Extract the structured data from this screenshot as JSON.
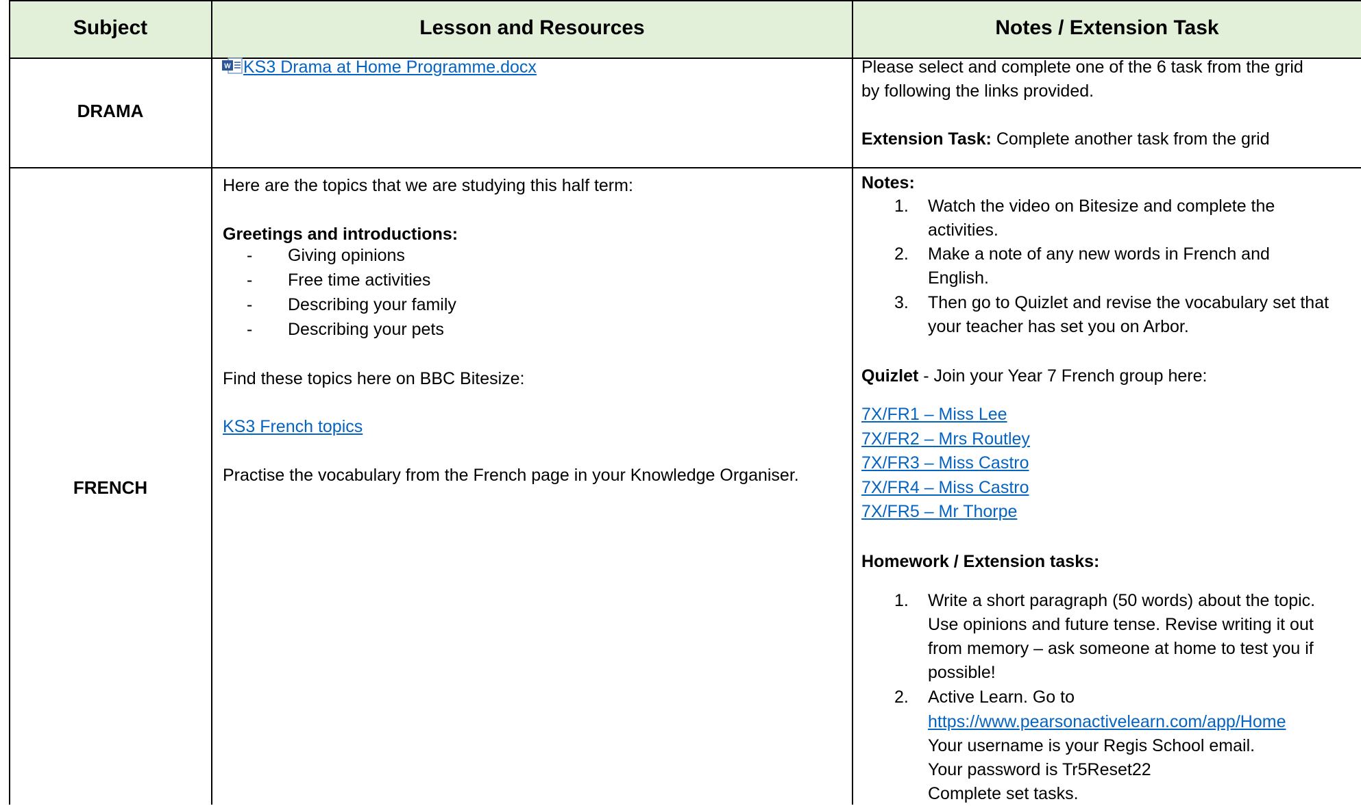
{
  "table": {
    "headers": {
      "subject": "Subject",
      "lesson": "Lesson and Resources",
      "notes": "Notes / Extension Task"
    }
  },
  "drama": {
    "subject": "DRAMA",
    "file_icon": "word-document-icon",
    "resource_link": "KS3 Drama at Home Programme.docx",
    "notes_line1": "Please select and complete one of the 6 task from the grid",
    "notes_line2": "by following the links provided.",
    "extension_label": "Extension Task:",
    "extension_text": " Complete another task from the grid"
  },
  "french": {
    "subject": "FRENCH",
    "intro": "Here are the topics that we are studying this half term:",
    "topic_heading": "Greetings and introductions:",
    "topics": [
      "Giving opinions",
      "Free time activities",
      "Describing your family",
      "Describing your pets"
    ],
    "bitesize_intro": "Find these topics here on BBC Bitesize:",
    "bitesize_link": "KS3 French topics",
    "practise": "Practise the vocabulary from the French page in your Knowledge Organiser.",
    "notes_label": "Notes:",
    "notes": [
      {
        "num": "1.",
        "lines": [
          "Watch the video on Bitesize and complete the",
          "activities."
        ]
      },
      {
        "num": "2.",
        "lines": [
          "Make a note of any new words in French and",
          "English."
        ]
      },
      {
        "num": "3.",
        "lines": [
          "Then go to Quizlet and revise the vocabulary set that",
          "your teacher has set you on Arbor."
        ]
      }
    ],
    "quizlet_label": "Quizlet",
    "quizlet_text": " - Join your Year 7 French group here:",
    "quizlet_links": [
      "7X/FR1 – Miss Lee",
      "7X/FR2 – Mrs Routley",
      "7X/FR3 – Miss Castro",
      "7X/FR4 – Miss Castro",
      "7X/FR5 – Mr Thorpe"
    ],
    "homework_label": "Homework / Extension tasks:",
    "task1": {
      "num": "1.",
      "lines": [
        "Write a short paragraph (50 words) about the topic.",
        "Use opinions and future tense. Revise writing it out",
        "from memory – ask someone at home to test you if",
        "possible!"
      ]
    },
    "task2": {
      "num": "2.",
      "line1": "Active Learn. Go to",
      "url": "https://www.pearsonactivelearn.com/app/Home",
      "line3": "Your username is your Regis School email.",
      "line4": "Your password is Tr5Reset22",
      "line5": "Complete set tasks."
    }
  },
  "colors": {
    "header_background": "#e2efd9",
    "link": "#0563c1",
    "border": "#000000"
  }
}
